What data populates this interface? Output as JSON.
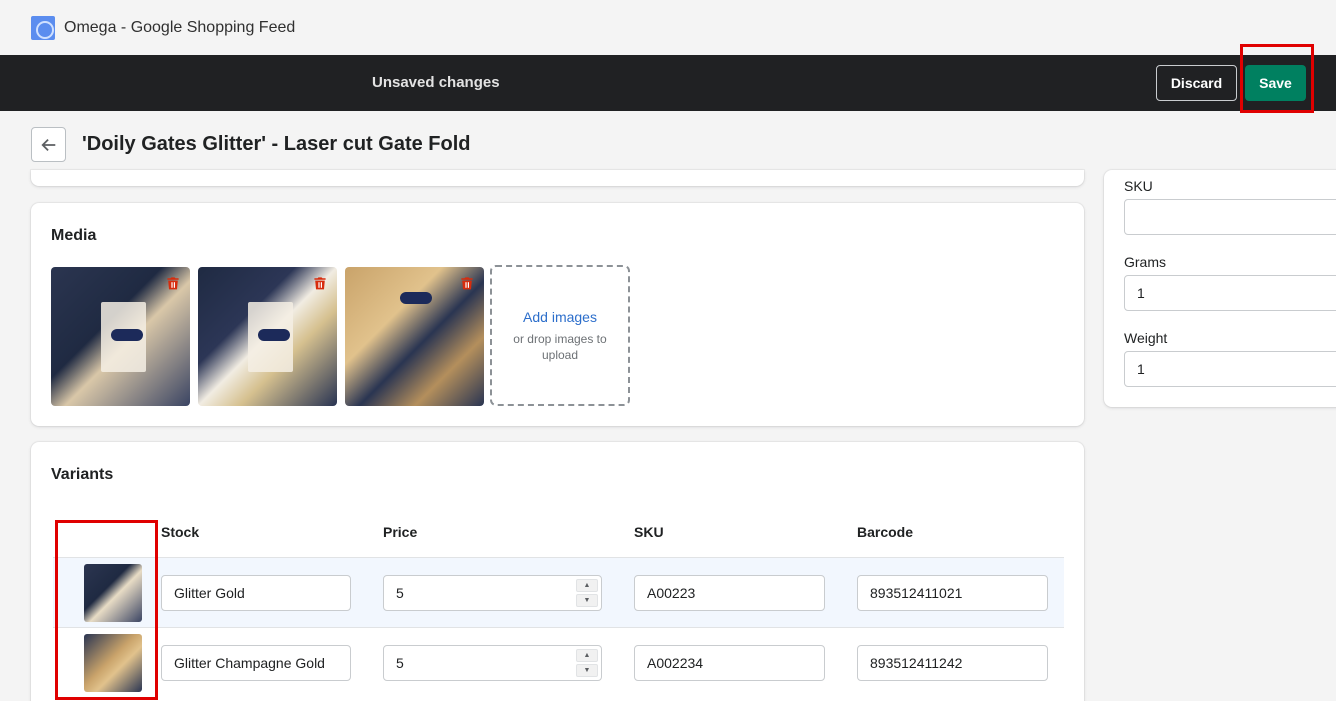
{
  "app": {
    "title": "Omega - Google Shopping Feed",
    "logo_icon": "omega-app-icon"
  },
  "context_bar": {
    "message": "Unsaved changes",
    "discard_label": "Discard",
    "save_label": "Save"
  },
  "page": {
    "title": "'Doily Gates Glitter' - Laser cut Gate Fold"
  },
  "media": {
    "title": "Media",
    "images": [
      {
        "alt": "product image 1"
      },
      {
        "alt": "product image 2"
      },
      {
        "alt": "product image 3"
      }
    ],
    "add_images_label": "Add images",
    "drop_hint": "or drop images to upload"
  },
  "variants": {
    "title": "Variants",
    "columns": [
      "Stock",
      "Price",
      "SKU",
      "Barcode"
    ],
    "rows": [
      {
        "stock": "Glitter Gold",
        "price": "5",
        "sku": "A00223",
        "barcode": "893512411021"
      },
      {
        "stock": "Glitter Champagne Gold",
        "price": "5",
        "sku": "A002234",
        "barcode": "893512411242"
      }
    ]
  },
  "side": {
    "sku_label": "SKU",
    "sku_value": "",
    "grams_label": "Grams",
    "grams_value": "1",
    "weight_label": "Weight",
    "weight_value": "1"
  },
  "colors": {
    "save": "#008060",
    "context_bar": "#202123",
    "highlight": "#e00000",
    "link": "#2c6ecb"
  }
}
